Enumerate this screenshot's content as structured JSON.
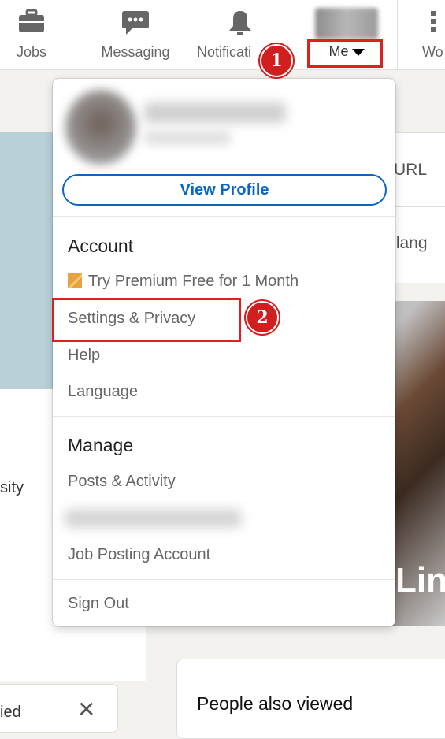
{
  "nav": {
    "items": [
      {
        "label": "Jobs",
        "icon": "briefcase-icon"
      },
      {
        "label": "Messaging",
        "icon": "chat-icon"
      },
      {
        "label": "Notificati",
        "icon": "bell-icon"
      }
    ],
    "me_label": "Me",
    "work_label": "Wo"
  },
  "dropdown": {
    "view_profile_label": "View Profile",
    "account": {
      "title": "Account",
      "items": [
        "Try Premium Free for 1 Month",
        "Settings & Privacy",
        "Help",
        "Language"
      ]
    },
    "manage": {
      "title": "Manage",
      "items": [
        "Posts & Activity",
        "Job Posting Account"
      ]
    },
    "sign_out_label": "Sign Out"
  },
  "background": {
    "right_url_text": "URL",
    "right_lang_text": "r lang",
    "ad_text": "Lin",
    "left_text_ity": "sity",
    "left_bottom_text": "ied",
    "close_symbol": "✕",
    "people_also_viewed": "People also viewed"
  },
  "annotations": {
    "step1": "1",
    "step2": "2",
    "highlight_color": "#e02020"
  },
  "colors": {
    "accent": "#0a66c2",
    "premium": "#e7a33e"
  }
}
